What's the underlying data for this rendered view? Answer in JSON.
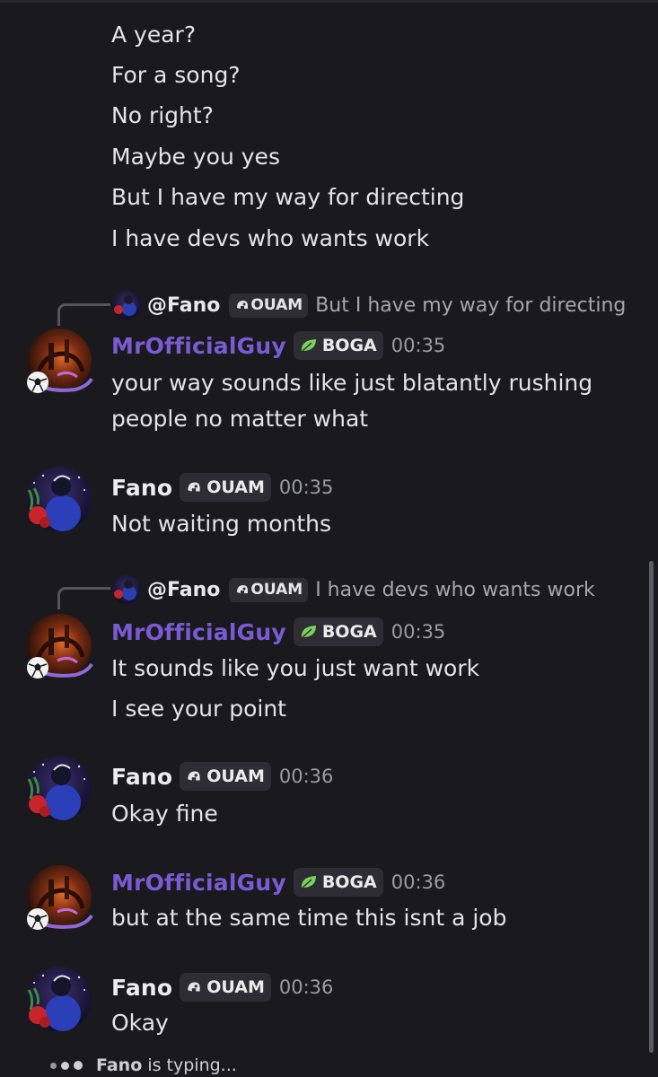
{
  "messages_top": {
    "lines": [
      "A year?",
      "For a song?",
      "No right?",
      "Maybe you yes",
      "But I have my way for directing",
      "I have devs who wants work"
    ]
  },
  "reply1": {
    "name": "@Fano",
    "tag": "OUAM",
    "text": "But I have my way for directing"
  },
  "msg1": {
    "author": "MrOfficialGuy",
    "tag": "BOGA",
    "time": "00:35",
    "lines": [
      "your way sounds like just blatantly rushing",
      "people no matter what"
    ]
  },
  "msg2": {
    "author": "Fano",
    "tag": "OUAM",
    "time": "00:35",
    "lines": [
      "Not waiting months"
    ]
  },
  "reply2": {
    "name": "@Fano",
    "tag": "OUAM",
    "text": "I have devs who wants work"
  },
  "msg3": {
    "author": "MrOfficialGuy",
    "tag": "BOGA",
    "time": "00:35",
    "lines": [
      "It sounds like you just want work",
      "I see your point"
    ]
  },
  "msg4": {
    "author": "Fano",
    "tag": "OUAM",
    "time": "00:36",
    "lines": [
      "Okay fine"
    ]
  },
  "msg5": {
    "author": "MrOfficialGuy",
    "tag": "BOGA",
    "time": "00:36",
    "lines": [
      "but at the same time this isnt a job"
    ]
  },
  "msg6": {
    "author": "Fano",
    "tag": "OUAM",
    "time": "00:36",
    "lines": [
      "Okay"
    ]
  },
  "typing": {
    "name": "Fano",
    "text": "is typing..."
  },
  "colors": {
    "background": "#1a1a1e",
    "mr_name": "#7a5bd3",
    "fano_name": "#ececf0",
    "tag_bg": "#2d2d33",
    "timestamp": "#9b9ba3"
  },
  "icons": {
    "ouam_tag": "helmet-icon",
    "boga_tag": "leaf-icon"
  }
}
